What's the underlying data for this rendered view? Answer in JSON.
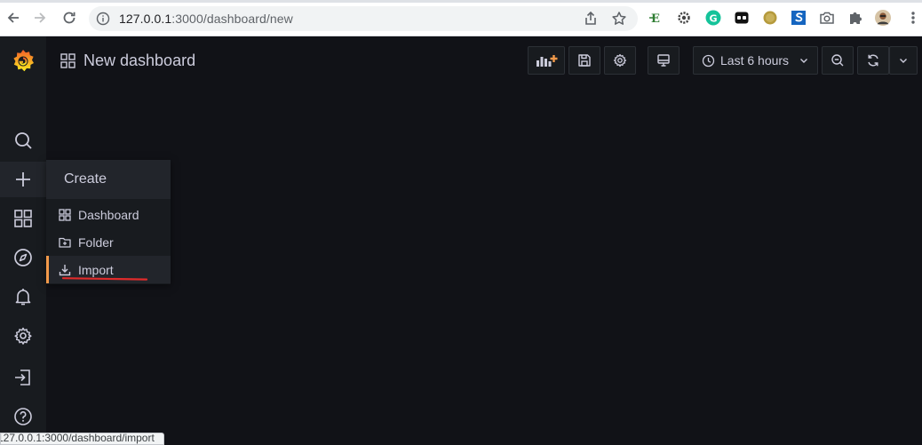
{
  "browser": {
    "url_host": "127.0.0.1",
    "url_path": ":3000/dashboard/new",
    "status_url": "127.0.0.1:3000/dashboard/import"
  },
  "topnav": {
    "title": "New dashboard",
    "time_range": "Last 6 hours"
  },
  "create_menu": {
    "header": "Create",
    "items": [
      {
        "label": "Dashboard",
        "icon": "apps-icon"
      },
      {
        "label": "Folder",
        "icon": "folder-plus-icon"
      },
      {
        "label": "Import",
        "icon": "import-icon"
      }
    ],
    "selected": "Import"
  },
  "colors": {
    "background": "#111217",
    "sidebar": "#181b1f",
    "accent": "#f2994a",
    "annotation": "#e02b2b"
  }
}
